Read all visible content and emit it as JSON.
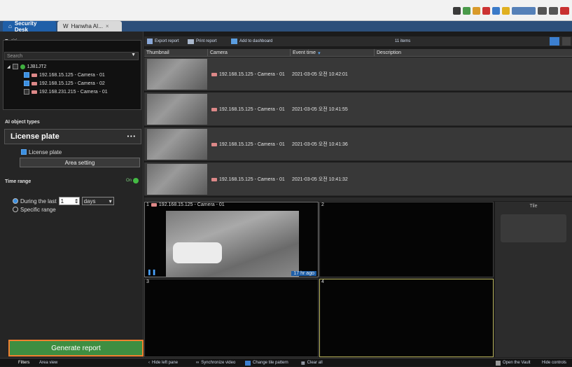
{
  "tabs": [
    {
      "label": "Security Desk"
    },
    {
      "label": "Hanwha AI..."
    }
  ],
  "left": {
    "entities_title": "Entities",
    "search_placeholder": "Search",
    "tree": [
      {
        "label": "1JB1JT2"
      },
      {
        "label": "192.168.15.125 - Camera - 01",
        "checked": true
      },
      {
        "label": "192.168.15.125 - Camera - 02",
        "checked": true
      },
      {
        "label": "192.168.231.215 - Camera - 01",
        "checked": false
      }
    ],
    "ai_title": "AI object types",
    "object_type": "License plate",
    "more": "• • •",
    "cb_label": "License plate",
    "area_setting": "Area setting",
    "time_title": "Time range",
    "toggle_label": "On",
    "during": "During the last",
    "during_value": "1",
    "unit": "days",
    "specific": "Specific range",
    "generate": "Generate report"
  },
  "toolbar": {
    "export": "Export report",
    "print": "Print report",
    "dashboard": "Add to dashboard",
    "count": "11 items"
  },
  "columns": [
    "Thumbnail",
    "Camera",
    "Event time",
    "Description"
  ],
  "rows": [
    {
      "camera": "192.168.15.125 - Camera - 01",
      "time": "2021-03-05 오전 10:42:01"
    },
    {
      "camera": "192.168.15.125 - Camera - 01",
      "time": "2021-03-05 오전 10:41:55"
    },
    {
      "camera": "192.168.15.125 - Camera - 01",
      "time": "2021-03-05 오전 10:41:36"
    },
    {
      "camera": "192.168.15.125 - Camera - 01",
      "time": "2021-03-05 오전 10:41:32"
    }
  ],
  "tiles": {
    "t1": "192.168.15.125 - Camera - 01",
    "t1_num": "1",
    "t2_num": "2",
    "t3_num": "3",
    "t4_num": "4",
    "t1_ago": "17 hr ago"
  },
  "ptz": {
    "title": "Tile"
  },
  "bottom": {
    "filters": "Filters",
    "area_view": "Area view",
    "hide_left": "Hide left pane",
    "sync": "Synchronize video",
    "pattern": "Change tile pattern",
    "clear": "Clear all",
    "vault": "Open the Vault",
    "hide_controls": "Hide controls"
  }
}
